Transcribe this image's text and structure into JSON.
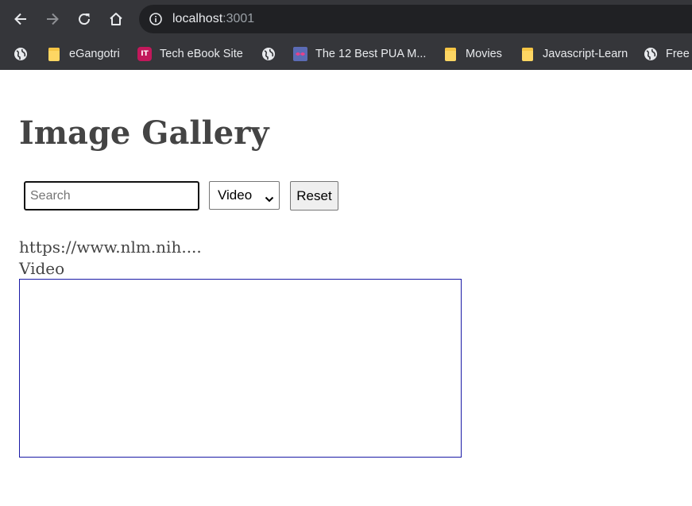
{
  "browser": {
    "url_host": "localhost",
    "url_port": ":3001",
    "nav": {
      "back_icon": "arrow-left-icon",
      "forward_icon": "arrow-right-icon",
      "reload_icon": "reload-icon",
      "home_icon": "home-icon",
      "info_icon": "info-circle-icon"
    },
    "bookmarks": [
      {
        "label": "",
        "icon": "globe-icon"
      },
      {
        "label": "eGangotri",
        "icon": "folder-icon"
      },
      {
        "label": "Tech eBook Site",
        "icon": "it-badge-icon",
        "badge_text": "IT"
      },
      {
        "label": "",
        "icon": "globe-icon"
      },
      {
        "label": "The 12 Best PUA M...",
        "icon": "site-favicon-icon"
      },
      {
        "label": "Movies",
        "icon": "folder-icon"
      },
      {
        "label": "Javascript-Learn",
        "icon": "folder-icon"
      },
      {
        "label": "Free",
        "icon": "globe-icon"
      }
    ]
  },
  "page": {
    "title": "Image Gallery",
    "search": {
      "placeholder": "Search",
      "value": ""
    },
    "filter": {
      "selected": "Video",
      "icon": "chevron-down-icon"
    },
    "reset_label": "Reset",
    "items": [
      {
        "url": "https://www.nlm.nih....",
        "type": "Video"
      }
    ]
  },
  "colors": {
    "chrome_bg": "#35363a",
    "omnibox_bg": "#202124",
    "text": "#444444",
    "frame_border": "#1a1aa6",
    "folder": "#fdd663"
  }
}
